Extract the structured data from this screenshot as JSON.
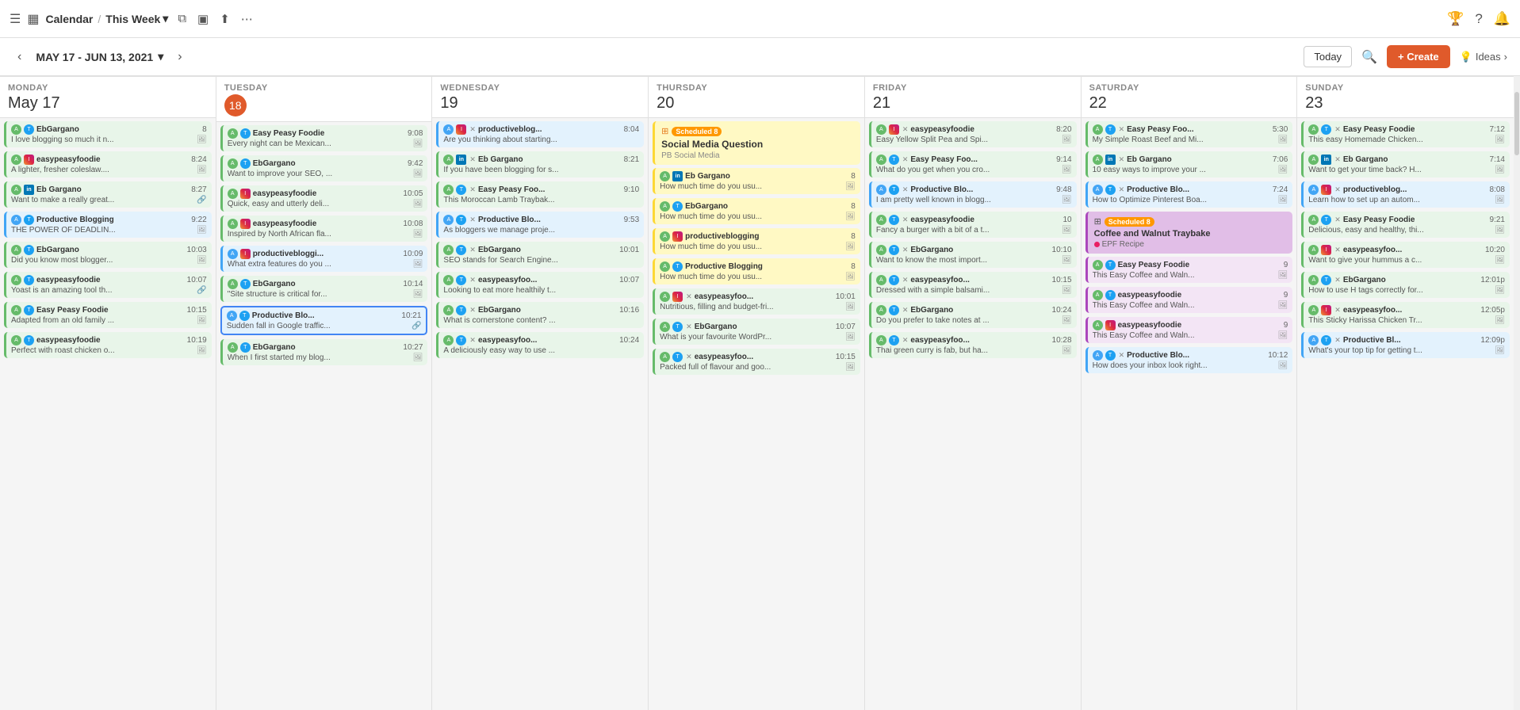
{
  "topNav": {
    "menuIcon": "☰",
    "calendarIcon": "▦",
    "title": "Calendar",
    "separator": "/",
    "weekLabel": "This Week",
    "dropdownIcon": "▾",
    "filterIcon": "⧉",
    "viewIcon": "▣",
    "shareIcon": "⬆",
    "moreIcon": "⋯",
    "trophyIcon": "🏆",
    "helpIcon": "?",
    "bellIcon": "🔔"
  },
  "dateBar": {
    "prevIcon": "‹",
    "nextIcon": "›",
    "dateRange": "MAY 17 - JUN 13, 2021",
    "dropdownIcon": "▾",
    "todayLabel": "Today",
    "searchIcon": "🔍",
    "createLabel": "+ Create",
    "ideasLabel": "Ideas",
    "ideasIcon": "💡",
    "ideasArrow": "›"
  },
  "days": [
    {
      "name": "MONDAY",
      "number": "May 17",
      "isToday": false
    },
    {
      "name": "TUESDAY",
      "number": "18",
      "isToday": true
    },
    {
      "name": "WEDNESDAY",
      "number": "19",
      "isToday": false
    },
    {
      "name": "THURSDAY",
      "number": "20",
      "isToday": false
    },
    {
      "name": "FRIDAY",
      "number": "21",
      "isToday": false
    },
    {
      "name": "SATURDAY",
      "number": "22",
      "isToday": false
    },
    {
      "name": "SUNDAY",
      "number": "23",
      "isToday": false
    }
  ],
  "columns": [
    {
      "day": "monday",
      "cards": [
        {
          "platform": "twitter",
          "account": "EbGargano",
          "time": "8",
          "text": "I love blogging so much it n...",
          "hasImage": true,
          "color": "green"
        },
        {
          "platform": "instagram",
          "account": "easypeasyfoodie",
          "time": "8:24",
          "text": "A lighter, fresher coleslaw....",
          "hasImage": true,
          "color": "green"
        },
        {
          "platform": "linkedin",
          "account": "Eb Gargano",
          "time": "8:27",
          "text": "Want to make a really great...",
          "hasLink": true,
          "color": "green"
        },
        {
          "platform": "twitter",
          "account": "Productive Blogging",
          "time": "9:22",
          "text": "THE POWER OF DEADLIN...",
          "hasImage": true,
          "color": "blue"
        },
        {
          "platform": "twitter",
          "account": "EbGargano",
          "time": "10:03",
          "text": "Did you know most blogger...",
          "hasImage": true,
          "color": "green"
        },
        {
          "platform": "twitter",
          "account": "easypeasyfoodie",
          "time": "10:07",
          "text": "Yoast is an amazing tool th...",
          "hasLink": true,
          "color": "green"
        },
        {
          "platform": "twitter",
          "account": "Easy Peasy Foodie",
          "time": "10:15",
          "text": "Adapted from an old family ...",
          "hasImage": true,
          "color": "green"
        },
        {
          "platform": "twitter",
          "account": "easypeasyfoodie",
          "time": "10:19",
          "text": "Perfect with roast chicken o...",
          "hasImage": true,
          "color": "green"
        }
      ]
    },
    {
      "day": "tuesday",
      "cards": [
        {
          "platform": "twitter",
          "account": "Easy Peasy Foodie",
          "time": "9:08",
          "text": "Every night can be Mexican...",
          "hasImage": true,
          "color": "green"
        },
        {
          "platform": "twitter",
          "account": "EbGargano",
          "time": "9:42",
          "text": "Want to improve your SEO, ...",
          "hasImage": true,
          "color": "green"
        },
        {
          "platform": "instagram",
          "account": "easypeasyfoodie",
          "time": "10:05",
          "text": "Quick, easy and utterly deli...",
          "hasImage": true,
          "color": "green"
        },
        {
          "platform": "instagram",
          "account": "easypeasyfoodie",
          "time": "10:08",
          "text": "Inspired by North African fla...",
          "hasImage": true,
          "color": "green"
        },
        {
          "platform": "instagram",
          "account": "productivebloggi...",
          "time": "10:09",
          "text": "What extra features do you ...",
          "hasImage": true,
          "color": "blue"
        },
        {
          "platform": "twitter",
          "account": "EbGargano",
          "time": "10:14",
          "text": "\"Site structure is critical for...",
          "hasImage": true,
          "color": "green"
        },
        {
          "platform": "twitter",
          "account": "Productive Blo...",
          "time": "10:21",
          "text": "Sudden fall in Google traffic...",
          "hasLink": true,
          "color": "blue",
          "highlighted": true
        },
        {
          "platform": "twitter",
          "account": "EbGargano",
          "time": "10:27",
          "text": "When I first started my blog...",
          "hasImage": true,
          "color": "green"
        }
      ]
    },
    {
      "day": "wednesday",
      "cards": [
        {
          "platform": "instagram",
          "account": "productiveblog...",
          "time": "8:04",
          "text": "Are you thinking about starting...",
          "hasImage": false,
          "color": "blue",
          "hasX": true
        },
        {
          "platform": "linkedin",
          "account": "Eb Gargano",
          "time": "8:21",
          "text": "If you have been blogging for s...",
          "color": "green",
          "hasX": true
        },
        {
          "platform": "twitter",
          "account": "Easy Peasy Foo...",
          "time": "9:10",
          "text": "This Moroccan Lamb Traybak...",
          "color": "green",
          "hasX": true
        },
        {
          "platform": "twitter",
          "account": "Productive Blo...",
          "time": "9:53",
          "text": "As bloggers we manage proje...",
          "color": "blue",
          "hasX": true
        },
        {
          "platform": "twitter",
          "account": "EbGargano",
          "time": "10:01",
          "text": "SEO stands for Search Engine...",
          "color": "green",
          "hasX": true
        },
        {
          "platform": "twitter",
          "account": "easypeasyfoo...",
          "time": "10:07",
          "text": "Looking to eat more healthily t...",
          "color": "green",
          "hasX": true
        },
        {
          "platform": "twitter",
          "account": "EbGargano",
          "time": "10:16",
          "text": "What is cornerstone content? ...",
          "color": "green",
          "hasX": true
        },
        {
          "platform": "twitter",
          "account": "easypeasyfoo...",
          "time": "10:24",
          "text": "A deliciously easy way to use ...",
          "color": "green",
          "hasX": true
        }
      ]
    },
    {
      "day": "thursday",
      "cards": [
        {
          "isCampaign": true,
          "title": "Social Media Question",
          "subtitle": "PB Social Media",
          "badge": "Scheduled 8",
          "color": "yellow"
        },
        {
          "platform": "linkedin",
          "account": "Eb Gargano",
          "time": "8",
          "text": "How much time do you usu...",
          "hasImage": true,
          "color": "yellow"
        },
        {
          "platform": "twitter",
          "account": "EbGargano",
          "time": "8",
          "text": "How much time do you usu...",
          "hasImage": true,
          "color": "yellow"
        },
        {
          "platform": "instagram",
          "account": "productiveblogging",
          "time": "8",
          "text": "How much time do you usu...",
          "hasImage": true,
          "color": "yellow"
        },
        {
          "platform": "twitter",
          "account": "Productive Blogging",
          "time": "8",
          "text": "How much time do you usu...",
          "hasImage": true,
          "color": "yellow"
        },
        {
          "platform": "instagram",
          "account": "easypeasyfoo...",
          "time": "10:01",
          "text": "Nutritious, filling and budget-fri...",
          "hasImage": true,
          "color": "green",
          "hasX": true
        },
        {
          "platform": "twitter",
          "account": "EbGargano",
          "time": "10:07",
          "text": "What is your favourite WordPr...",
          "hasImage": true,
          "color": "green",
          "hasX": true
        },
        {
          "platform": "twitter",
          "account": "easypeasyfoo...",
          "time": "10:15",
          "text": "Packed full of flavour and goo...",
          "hasImage": true,
          "color": "green",
          "hasX": true
        }
      ]
    },
    {
      "day": "friday",
      "cards": [
        {
          "platform": "instagram",
          "account": "easypeasyfoodie",
          "time": "8:20",
          "text": "Easy Yellow Split Pea and Spi...",
          "hasImage": true,
          "color": "green",
          "hasX": true
        },
        {
          "platform": "twitter",
          "account": "Easy Peasy Foo...",
          "time": "9:14",
          "text": "What do you get when you cro...",
          "hasImage": true,
          "color": "green",
          "hasX": true
        },
        {
          "platform": "twitter",
          "account": "Productive Blo...",
          "time": "9:48",
          "text": "I am pretty well known in blogg...",
          "hasImage": true,
          "color": "blue",
          "hasX": true
        },
        {
          "platform": "twitter",
          "account": "easypeasyfoodie",
          "time": "10",
          "text": "Fancy a burger with a bit of a t...",
          "hasImage": true,
          "color": "green",
          "hasX": true
        },
        {
          "platform": "twitter",
          "account": "EbGargano",
          "time": "10:10",
          "text": "Want to know the most import...",
          "hasImage": true,
          "color": "green",
          "hasX": true
        },
        {
          "platform": "twitter",
          "account": "easypeasyfoo...",
          "time": "10:15",
          "text": "Dressed with a simple balsami...",
          "hasImage": true,
          "color": "green",
          "hasX": true
        },
        {
          "platform": "twitter",
          "account": "EbGargano",
          "time": "10:24",
          "text": "Do you prefer to take notes at ...",
          "hasImage": true,
          "color": "green",
          "hasX": true
        },
        {
          "platform": "twitter",
          "account": "easypeasyfoo...",
          "time": "10:28",
          "text": "Thai green curry is fab, but ha...",
          "hasImage": true,
          "color": "green",
          "hasX": true
        }
      ]
    },
    {
      "day": "saturday",
      "cards": [
        {
          "platform": "twitter",
          "account": "Easy Peasy Foo...",
          "time": "5:30",
          "text": "My Simple Roast Beef and Mi...",
          "hasImage": true,
          "color": "green",
          "hasX": true
        },
        {
          "platform": "linkedin",
          "account": "Eb Gargano",
          "time": "7:06",
          "text": "10 easy ways to improve your ...",
          "hasImage": true,
          "color": "green",
          "hasX": true
        },
        {
          "platform": "twitter",
          "account": "Productive Blo...",
          "time": "7:24",
          "text": "How to Optimize Pinterest Boa...",
          "hasImage": true,
          "color": "blue",
          "hasX": true
        },
        {
          "isCampaign": true,
          "isPurple": true,
          "title": "Coffee and Walnut Traybake",
          "subtitle": "EPF Recipe",
          "badge": "Scheduled 8",
          "color": "purple"
        },
        {
          "platform": "twitter",
          "account": "Easy Peasy Foodie",
          "time": "9",
          "text": "This Easy Coffee and Waln...",
          "hasImage": true,
          "color": "purple"
        },
        {
          "platform": "twitter",
          "account": "easypeasyfoodie",
          "time": "9",
          "text": "This Easy Coffee and Waln...",
          "hasImage": true,
          "color": "purple"
        },
        {
          "platform": "instagram",
          "account": "easypeasyfoodie",
          "time": "9",
          "text": "This Easy Coffee and Waln...",
          "hasImage": true,
          "color": "purple"
        },
        {
          "platform": "twitter",
          "account": "Productive Blo...",
          "time": "10:12",
          "text": "How does your inbox look right...",
          "hasImage": true,
          "color": "blue",
          "hasX": true
        }
      ]
    },
    {
      "day": "sunday",
      "cards": [
        {
          "platform": "twitter",
          "account": "Easy Peasy Foodie",
          "time": "7:12",
          "text": "This easy Homemade Chicken...",
          "hasImage": true,
          "color": "green",
          "hasX": true
        },
        {
          "platform": "linkedin",
          "account": "Eb Gargano",
          "time": "7:14",
          "text": "Want to get your time back? H...",
          "hasImage": true,
          "color": "green",
          "hasX": true
        },
        {
          "platform": "instagram",
          "account": "productiveblog...",
          "time": "8:08",
          "text": "Learn how to set up an autom...",
          "hasImage": true,
          "color": "blue",
          "hasX": true
        },
        {
          "platform": "twitter",
          "account": "Easy Peasy Foodie",
          "time": "9:21",
          "text": "Delicious, easy and healthy, thi...",
          "hasImage": true,
          "color": "green",
          "hasX": true
        },
        {
          "platform": "instagram",
          "account": "easypeasyfoo...",
          "time": "10:20",
          "text": "Want to give your hummus a c...",
          "hasImage": true,
          "color": "green",
          "hasX": true
        },
        {
          "platform": "twitter",
          "account": "EbGargano",
          "time": "12:01p",
          "text": "How to use H tags correctly for...",
          "hasImage": true,
          "color": "green",
          "hasX": true
        },
        {
          "platform": "instagram",
          "account": "easypeasyfoo...",
          "time": "12:05p",
          "text": "This Sticky Harissa Chicken Tr...",
          "hasImage": true,
          "color": "green",
          "hasX": true
        },
        {
          "platform": "twitter",
          "account": "Productive Bl...",
          "time": "12:09p",
          "text": "What's your top tip for getting t...",
          "hasImage": true,
          "color": "blue",
          "hasX": true
        }
      ]
    }
  ]
}
